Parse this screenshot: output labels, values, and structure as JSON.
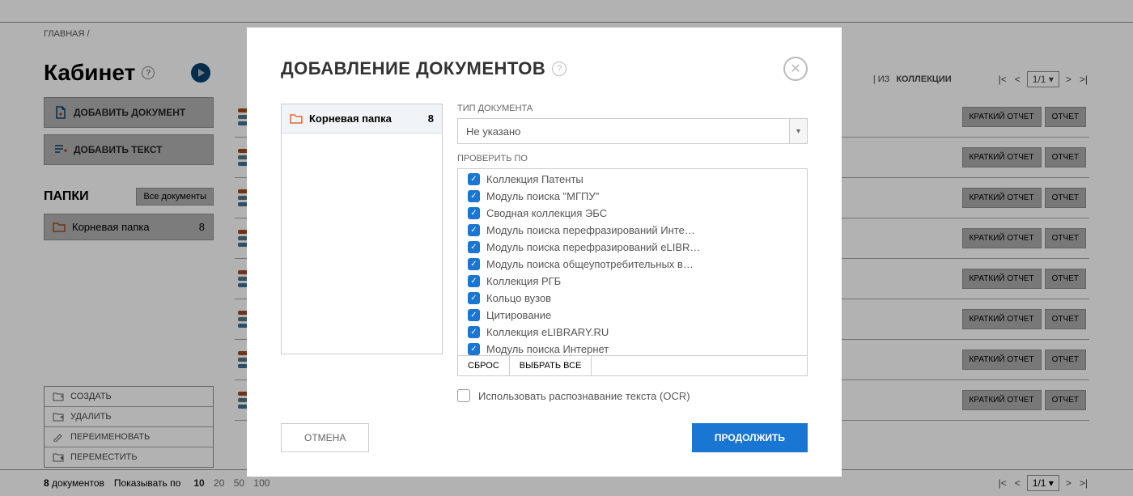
{
  "breadcrumb": "ГЛАВНАЯ /",
  "page_title": "Кабинет",
  "sidebar": {
    "add_doc": "ДОБАВИТЬ ДОКУМЕНТ",
    "add_text": "ДОБАВИТЬ ТЕКСТ",
    "folders_title": "ПАПКИ",
    "all_docs": "Все документы",
    "root_folder": "Корневая папка",
    "root_count": "8",
    "actions": {
      "create": "СОЗДАТЬ",
      "delete": "УДАЛИТЬ",
      "rename": "ПЕРЕИМЕНОВАТЬ",
      "move": "ПЕРЕМЕСТИТЬ"
    }
  },
  "toolbar": {
    "from": "ИЗ",
    "collections": "КОЛЛЕКЦИИ"
  },
  "pagination": {
    "page": "1/1"
  },
  "doc_buttons": {
    "short_report": "КРАТКИЙ ОТЧЕТ",
    "report": "ОТЧЕТ"
  },
  "footer": {
    "count": "8",
    "count_label": "документов",
    "show_by": "Показывать по",
    "sizes": [
      "10",
      "20",
      "50",
      "100"
    ]
  },
  "modal": {
    "title": "ДОБАВЛЕНИЕ ДОКУМЕНТОВ",
    "folder_name": "Корневая папка",
    "folder_count": "8",
    "doc_type_label": "ТИП ДОКУМЕНТА",
    "doc_type_value": "Не указано",
    "check_by_label": "ПРОВЕРИТЬ ПО",
    "collections": [
      "Коллекция Патенты",
      "Модуль поиска \"МГПУ\"",
      "Сводная коллекция ЭБС",
      "Модуль поиска перефразирований Инте…",
      "Модуль поиска перефразирований eLIBR…",
      "Модуль поиска общеупотребительных в…",
      "Коллекция РГБ",
      "Кольцо вузов",
      "Цитирование",
      "Коллекция eLIBRARY.RU",
      "Модуль поиска Интернет"
    ],
    "reset": "СБРОС",
    "select_all": "ВЫБРАТЬ ВСЕ",
    "ocr": "Использовать распознавание текста (OCR)",
    "cancel": "ОТМЕНА",
    "continue": "ПРОДОЛЖИТЬ"
  }
}
